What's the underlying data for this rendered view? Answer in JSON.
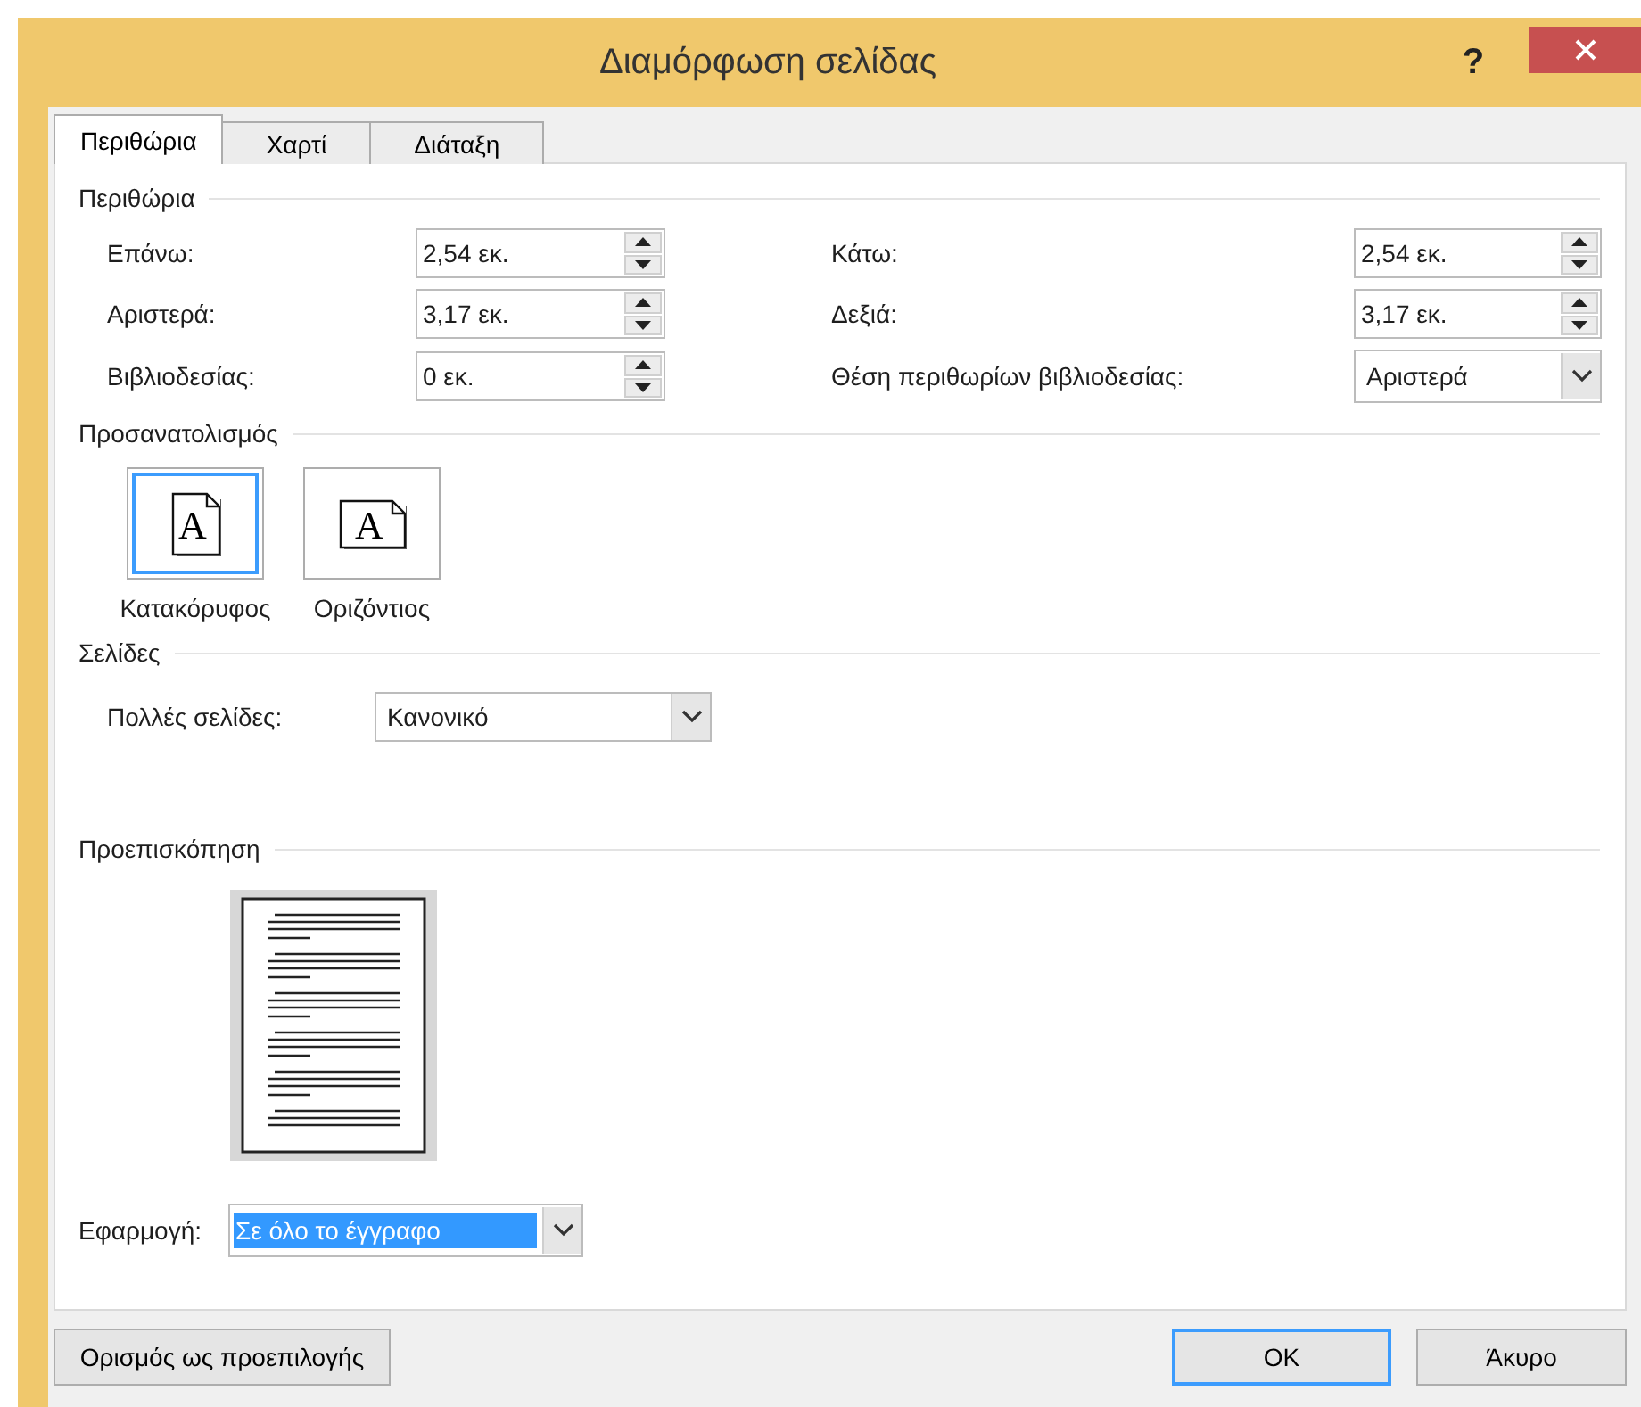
{
  "window": {
    "title": "Διαμόρφωση σελίδας",
    "help": "?"
  },
  "tabs": [
    {
      "label": "Περιθώρια",
      "selected": true
    },
    {
      "label": "Χαρτί",
      "selected": false
    },
    {
      "label": "Διάταξη",
      "selected": false
    }
  ],
  "margins": {
    "title": "Περιθώρια",
    "fields": [
      {
        "label": "Επάνω:",
        "value": "2,54 εκ.",
        "kind": "spinner"
      },
      {
        "label": "Κάτω:",
        "value": "2,54 εκ.",
        "kind": "spinner"
      },
      {
        "label": "Αριστερά:",
        "value": "3,17 εκ.",
        "kind": "spinner"
      },
      {
        "label": "Δεξιά:",
        "value": "3,17 εκ.",
        "kind": "spinner"
      },
      {
        "label": "Βιβλιοδεσίας:",
        "value": "0 εκ.",
        "kind": "spinner"
      },
      {
        "label": "Θέση περιθωρίων βιβλιοδεσίας:",
        "value": "Αριστερά",
        "kind": "dropdown"
      }
    ]
  },
  "orientation": {
    "title": "Προσανατολισμός",
    "options": [
      {
        "label": "Κατακόρυφος",
        "kind": "portrait",
        "icon_letter": "A",
        "selected": true
      },
      {
        "label": "Οριζόντιος",
        "kind": "landscape",
        "icon_letter": "A",
        "selected": false
      }
    ]
  },
  "pages": {
    "title": "Σελίδες",
    "label": "Πολλές σελίδες:",
    "value": "Κανονικό"
  },
  "preview": {
    "title": "Προεπισκόπηση"
  },
  "apply": {
    "label": "Εφαρμογή:",
    "value": "Σε όλο το έγγραφο"
  },
  "buttons": [
    {
      "label": "Ορισμός ως προεπιλογής",
      "default": false
    },
    {
      "label": "OK",
      "default": true
    },
    {
      "label": "Άκυρο",
      "default": false
    }
  ]
}
